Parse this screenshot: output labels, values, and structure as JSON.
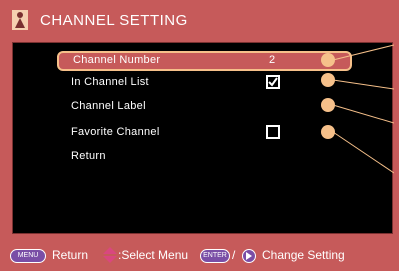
{
  "title": "CHANNEL SETTING",
  "menu": {
    "items": [
      {
        "label": "Channel Number",
        "value": "2"
      },
      {
        "label": "In Channel List",
        "checked": true
      },
      {
        "label": "Channel Label"
      },
      {
        "label": "Favorite Channel",
        "checked": false
      },
      {
        "label": "Return"
      }
    ],
    "selected_index": 0
  },
  "footer": {
    "menu_key": "MENU",
    "return_label": "Return",
    "select_label": ":Select Menu",
    "enter_key": "ENTER",
    "slash": "/",
    "change_label": "Change Setting"
  },
  "icons": {
    "title": "person-icon",
    "select": "up-down-arrow-icon",
    "right": "right-arrow-icon",
    "check": "checkmark-icon",
    "callout": "callout-dot-icon"
  },
  "colors": {
    "frame": "#c65a5a",
    "highlight_border": "#f6c08a",
    "dot": "#f6c08a",
    "key_pill": "#7a4ea6"
  }
}
